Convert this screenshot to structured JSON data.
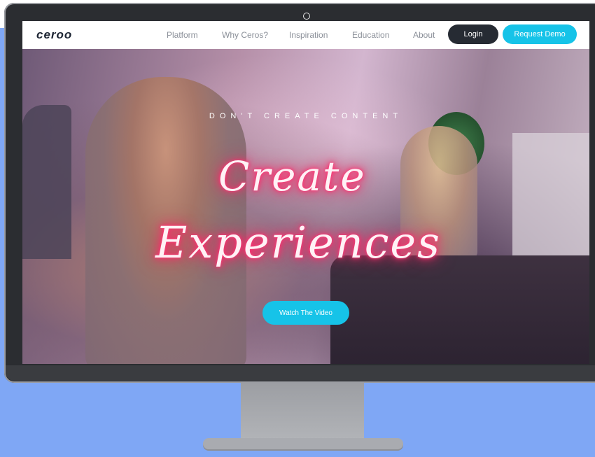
{
  "brand": {
    "logo_text": "ceroo"
  },
  "nav": {
    "links": [
      "Platform",
      "Why Ceros?",
      "Inspiration",
      "Education",
      "About"
    ],
    "login_label": "Login",
    "demo_label": "Request Demo"
  },
  "hero": {
    "tagline": "DON'T CREATE CONTENT",
    "headline_line1": "Create",
    "headline_line2": "Experiences",
    "cta_label": "Watch The Video"
  },
  "colors": {
    "page_bg": "#7fa7f5",
    "accent": "#16c3e8",
    "login_bg": "#262b33",
    "neon_glow": "#ff2b6b"
  }
}
